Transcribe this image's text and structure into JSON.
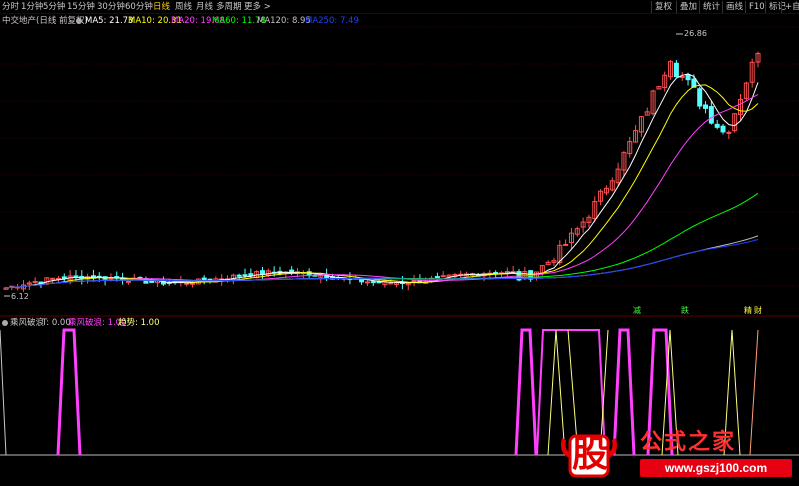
{
  "toolbar": {
    "periods": [
      "分时",
      "1分钟",
      "5分钟",
      "15分钟",
      "30分钟",
      "60分钟",
      "日线",
      "周线",
      "月线",
      "多周期",
      "更多 >"
    ],
    "active_period": "日线",
    "right_buttons": [
      "复权",
      "叠加",
      "统计",
      "画线",
      "F10",
      "标记",
      "+自选"
    ]
  },
  "main_legend": {
    "title": "中交地产(日线 前复权)",
    "ma5": "MA5: 21.73",
    "ma10": "MA10: 20.31",
    "ma20": "MA20: 19.68",
    "ma60": "MA60: 11.78",
    "ma120": "MA120: 8.95",
    "ma250": "MA250: 7.49",
    "colors": {
      "ma5": "#ffffff",
      "ma10": "#ffff00",
      "ma20": "#ff40ff",
      "ma60": "#00ff00",
      "ma120": "#c0c0c0",
      "ma250": "#2040ff"
    }
  },
  "chart_annotations": {
    "high_price": "26.86",
    "low_price": "6.12",
    "markers": [
      {
        "text": "减",
        "color": "#40ff40"
      },
      {
        "text": "跌",
        "color": "#40ff40"
      },
      {
        "text": "精",
        "color": "#ffff40"
      },
      {
        "text": "财",
        "color": "#ffff40"
      }
    ]
  },
  "sub_legend": {
    "indicator": "乘风破浪",
    "t_value": "T: 0.00",
    "line1": "乘风破浪: 1.00",
    "line2": "趋势: 1.00",
    "colors": {
      "t": "#c8c8c8",
      "line1": "#ff40ff",
      "line2": "#ffff80"
    }
  },
  "colors": {
    "up": "#ff5050",
    "down": "#54ffff",
    "grid": "#3a0000",
    "background": "#000000"
  },
  "watermark": {
    "logo_char": "股",
    "title": "公式之家",
    "url": "www.gszj100.com"
  }
}
